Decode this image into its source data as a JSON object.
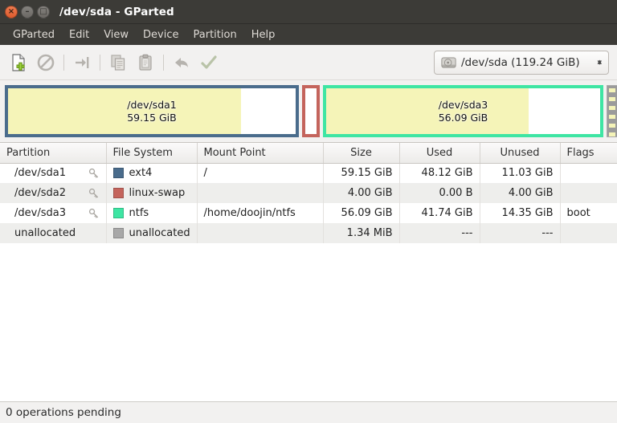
{
  "window": {
    "title": "/dev/sda - GParted",
    "controls": [
      {
        "name": "close",
        "glyph": "×"
      },
      {
        "name": "minimize",
        "glyph": "–"
      },
      {
        "name": "maximize",
        "glyph": "□"
      }
    ]
  },
  "menubar": {
    "items": [
      {
        "label": "GParted"
      },
      {
        "label": "Edit"
      },
      {
        "label": "View"
      },
      {
        "label": "Device"
      },
      {
        "label": "Partition"
      },
      {
        "label": "Help"
      }
    ]
  },
  "toolbar": {
    "buttons": [
      {
        "name": "new-partition-button",
        "icon": "new-document-icon",
        "enabled": true
      },
      {
        "name": "delete-partition-button",
        "icon": "delete-prohibited-icon",
        "enabled": false
      },
      {
        "name": "resize-move-button",
        "icon": "resize-arrow-icon",
        "enabled": false
      },
      {
        "name": "copy-button",
        "icon": "copy-icon",
        "enabled": false
      },
      {
        "name": "paste-button",
        "icon": "paste-clipboard-icon",
        "enabled": false
      },
      {
        "name": "undo-button",
        "icon": "undo-arrow-icon",
        "enabled": false
      },
      {
        "name": "apply-button",
        "icon": "apply-checkmark-icon",
        "enabled": false
      }
    ],
    "device_selector": {
      "icon": "hard-disk-icon",
      "value": "/dev/sda  (119.24 GiB)"
    }
  },
  "diskview": {
    "partitions": [
      {
        "name": "sda1",
        "label_line1": "/dev/sda1",
        "label_line2": "59.15 GiB",
        "border_color": "#4a6c8c",
        "used_pct": 81
      },
      {
        "name": "sda2",
        "label_line1": "",
        "label_line2": "",
        "border_color": "#c4645c",
        "used_pct": 0
      },
      {
        "name": "sda3",
        "label_line1": "/dev/sda3",
        "label_line2": "56.09 GiB",
        "border_color": "#3ee5a3",
        "used_pct": 74
      },
      {
        "name": "unallocated",
        "label_line1": "",
        "label_line2": "",
        "border_color": "#9b9b9b",
        "used_pct": 0
      }
    ]
  },
  "table": {
    "columns": [
      "Partition",
      "File System",
      "Mount Point",
      "Size",
      "Used",
      "Unused",
      "Flags"
    ],
    "rows": [
      {
        "partition": "/dev/sda1",
        "key_icon": "key-icon",
        "filesystem": "ext4",
        "fs_color": "#4a6c8c",
        "mount_point": "/",
        "size": "59.15 GiB",
        "used": "48.12 GiB",
        "unused": "11.03 GiB",
        "flags": ""
      },
      {
        "partition": "/dev/sda2",
        "key_icon": "key-icon",
        "filesystem": "linux-swap",
        "fs_color": "#c4645c",
        "mount_point": "",
        "size": "4.00 GiB",
        "used": "0.00 B",
        "unused": "4.00 GiB",
        "flags": ""
      },
      {
        "partition": "/dev/sda3",
        "key_icon": "key-icon",
        "filesystem": "ntfs",
        "fs_color": "#3ee5a3",
        "mount_point": "/home/doojin/ntfs",
        "size": "56.09 GiB",
        "used": "41.74 GiB",
        "unused": "14.35 GiB",
        "flags": "boot"
      },
      {
        "partition": "unallocated",
        "key_icon": "",
        "filesystem": "unallocated",
        "fs_color": "#a8a8a8",
        "mount_point": "",
        "size": "1.34 MiB",
        "used": "---",
        "unused": "---",
        "flags": ""
      }
    ]
  },
  "statusbar": {
    "text": "0 operations pending"
  }
}
